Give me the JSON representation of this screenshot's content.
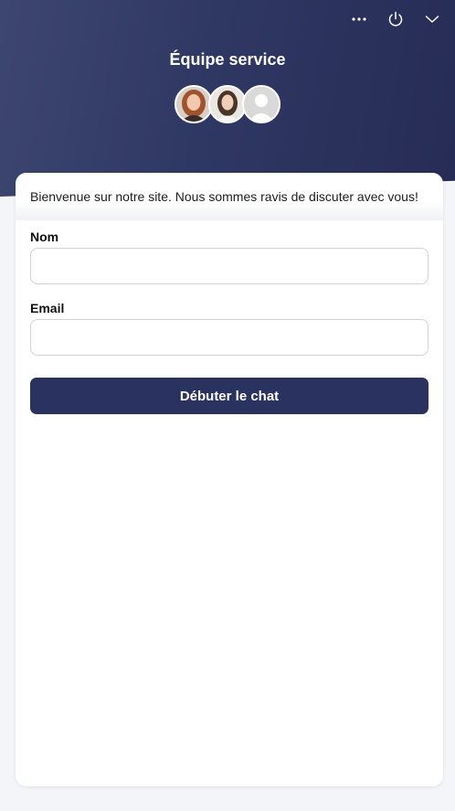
{
  "header": {
    "title": "Équipe service",
    "controls": {
      "more_icon": "more-horizontal-icon",
      "power_icon": "power-icon",
      "minimize_icon": "chevron-down-icon"
    },
    "avatars": [
      {
        "kind": "photo-red-hair"
      },
      {
        "kind": "photo-dark-hair"
      },
      {
        "kind": "placeholder"
      }
    ]
  },
  "card": {
    "welcome_text": "Bienvenue sur notre site. Nous sommes ravis de discuter avec vous!",
    "fields": {
      "name_label": "Nom",
      "name_value": "",
      "email_label": "Email",
      "email_value": ""
    },
    "start_button_label": "Débuter le chat"
  },
  "colors": {
    "header_dark": "#262c55",
    "button": "#2a3260"
  }
}
